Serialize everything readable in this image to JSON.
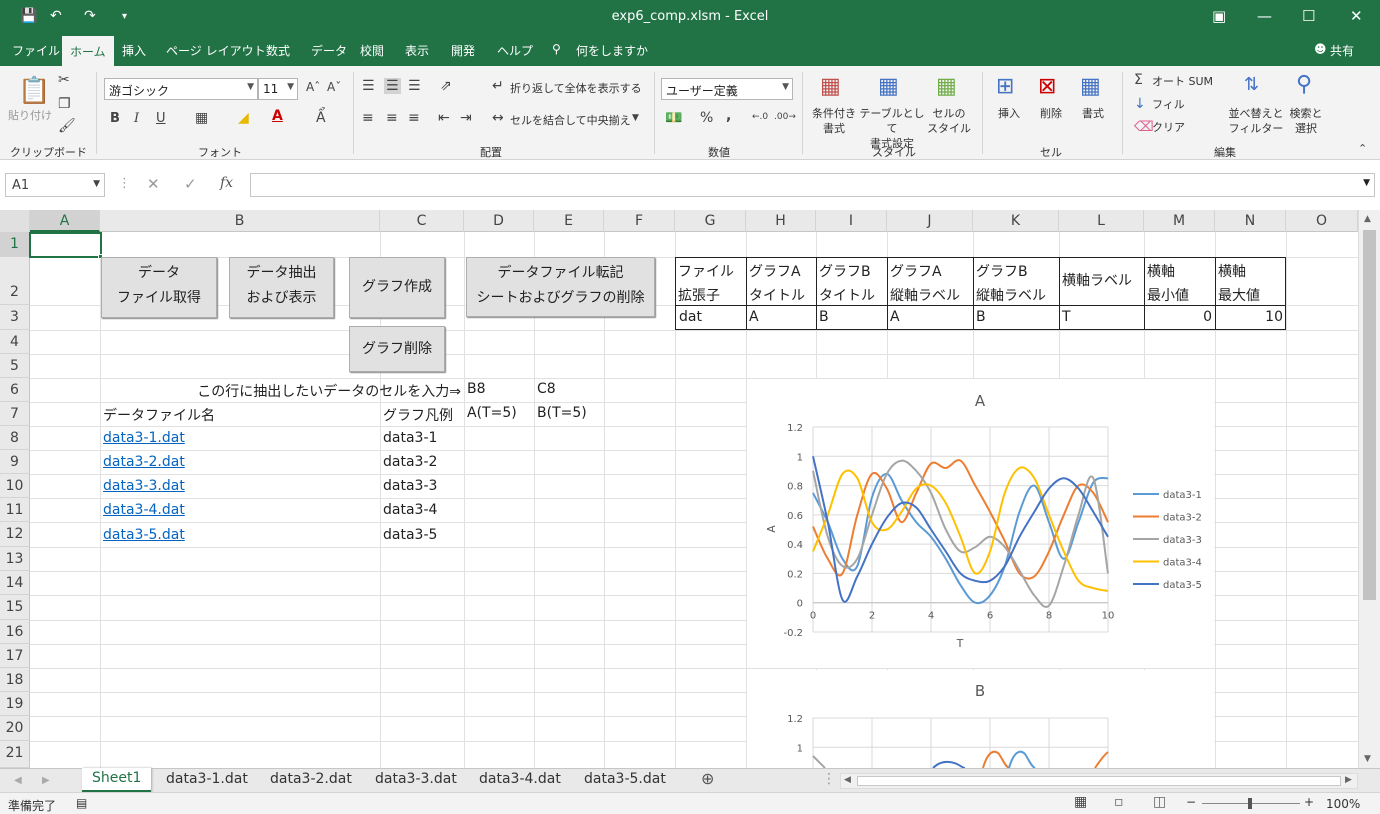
{
  "window": {
    "title": "exp6_comp.xlsm  -  Excel"
  },
  "menu": {
    "tabs": [
      "ファイル",
      "ホーム",
      "挿入",
      "ページ レイアウト",
      "数式",
      "データ",
      "校閲",
      "表示",
      "開発",
      "ヘルプ",
      "何をしますか"
    ],
    "active": "ホーム",
    "share": "共有"
  },
  "ribbon": {
    "clipboard": {
      "paste": "貼り付け",
      "group": "クリップボード"
    },
    "font": {
      "name": "游ゴシック",
      "size": "11",
      "bold": "B",
      "italic": "I",
      "underline": "U",
      "group": "フォント"
    },
    "alignment": {
      "wrap": "折り返して全体を表示する",
      "merge": "セルを結合して中央揃え",
      "group": "配置"
    },
    "number": {
      "format": "ユーザー定義",
      "percent": "%",
      "comma": ",",
      "group": "数値"
    },
    "styles": {
      "conditional": "条件付き\n書式",
      "table": "テーブルとして\n書式設定",
      "cell": "セルの\nスタイル",
      "group": "スタイル"
    },
    "cells": {
      "insert": "挿入",
      "delete": "削除",
      "format": "書式",
      "group": "セル"
    },
    "editing": {
      "autosum": "オート SUM",
      "fill": "フィル",
      "clear": "クリア",
      "sort": "並べ替えと\nフィルター",
      "find": "検索と\n選択",
      "group": "編集"
    }
  },
  "formula_bar": {
    "name_box": "A1",
    "fx": "fx",
    "value": ""
  },
  "columns": [
    "A",
    "B",
    "C",
    "D",
    "E",
    "F",
    "G",
    "H",
    "I",
    "J",
    "K",
    "L",
    "M",
    "N",
    "O"
  ],
  "rows": [
    "1",
    "2",
    "3",
    "4",
    "5",
    "6",
    "7",
    "8",
    "9",
    "10",
    "11",
    "12",
    "13",
    "14",
    "15",
    "16",
    "17",
    "18",
    "19",
    "20",
    "21"
  ],
  "buttons": {
    "get_file_l1": "データ",
    "get_file_l2": "ファイル取得",
    "extract_l1": "データ抽出",
    "extract_l2": "および表示",
    "make_graph": "グラフ作成",
    "delete_graph": "グラフ削除",
    "delete_sheets_l1": "データファイル転記",
    "delete_sheets_l2": "シートおよびグラフの削除"
  },
  "settings_table": {
    "headers": [
      [
        "ファイル",
        "拡張子"
      ],
      [
        "グラフA",
        "タイトル"
      ],
      [
        "グラフB",
        "タイトル"
      ],
      [
        "グラフA",
        "縦軸ラベル"
      ],
      [
        "グラフB",
        "縦軸ラベル"
      ],
      [
        "横軸ラベル",
        ""
      ],
      [
        "横軸",
        "最小値"
      ],
      [
        "横軸",
        "最大値"
      ]
    ],
    "values": [
      "dat",
      "A",
      "B",
      "A",
      "B",
      "T",
      "0",
      "10"
    ]
  },
  "cells": {
    "b6": "この行に抽出したいデータのセルを入力⇒",
    "d6": "B8",
    "e6": "C8",
    "b7": "データファイル名",
    "c7": "グラフ凡例",
    "d7": "A(T=5)",
    "e7": "B(T=5)",
    "files": [
      "data3-1.dat",
      "data3-2.dat",
      "data3-3.dat",
      "data3-4.dat",
      "data3-5.dat"
    ],
    "legends": [
      "data3-1",
      "data3-2",
      "data3-3",
      "data3-4",
      "data3-5"
    ]
  },
  "sheet_tabs": [
    "Sheet1",
    "data3-1.dat",
    "data3-2.dat",
    "data3-3.dat",
    "data3-4.dat",
    "data3-5.dat"
  ],
  "active_sheet": "Sheet1",
  "status": {
    "ready": "準備完了",
    "zoom": "100%"
  },
  "colors": {
    "excel_green": "#217346",
    "link": "#0563c1"
  },
  "chart_data": [
    {
      "type": "line",
      "title": "A",
      "xlabel": "T",
      "ylabel": "A",
      "xlim": [
        0,
        10
      ],
      "ylim": [
        -0.2,
        1.2
      ],
      "xticks": [
        "0",
        "2",
        "4",
        "6",
        "8",
        "10"
      ],
      "yticks": [
        "1.2",
        "1",
        "0.8",
        "0.6",
        "0.4",
        "0.2",
        "0",
        "-0.2"
      ],
      "legend_position": "right",
      "grid": true,
      "x": [
        0,
        0.5,
        1,
        1.5,
        2,
        2.5,
        3,
        3.5,
        4,
        4.5,
        5,
        5.5,
        6,
        6.5,
        7,
        7.5,
        8,
        8.5,
        9,
        9.5,
        10
      ],
      "series": [
        {
          "name": "data3-1",
          "color": "#5b9bd5",
          "values": [
            0.75,
            0.55,
            0.3,
            0.25,
            0.72,
            0.88,
            0.7,
            0.55,
            0.45,
            0.3,
            0.12,
            0.0,
            0.05,
            0.25,
            0.62,
            0.8,
            0.55,
            0.3,
            0.55,
            0.82,
            0.85
          ]
        },
        {
          "name": "data3-2",
          "color": "#ed7d31",
          "values": [
            0.52,
            0.3,
            0.2,
            0.6,
            0.88,
            0.78,
            0.55,
            0.75,
            0.95,
            0.92,
            0.97,
            0.8,
            0.62,
            0.42,
            0.2,
            0.18,
            0.35,
            0.6,
            0.8,
            0.75,
            0.55
          ]
        },
        {
          "name": "data3-3",
          "color": "#a5a5a5",
          "values": [
            0.9,
            0.45,
            0.25,
            0.3,
            0.6,
            0.88,
            0.97,
            0.9,
            0.75,
            0.5,
            0.35,
            0.38,
            0.45,
            0.38,
            0.22,
            0.05,
            -0.02,
            0.25,
            0.6,
            0.85,
            0.2
          ]
        },
        {
          "name": "data3-4",
          "color": "#ffc000",
          "values": [
            0.35,
            0.6,
            0.88,
            0.85,
            0.55,
            0.5,
            0.62,
            0.78,
            0.8,
            0.68,
            0.45,
            0.2,
            0.35,
            0.75,
            0.92,
            0.85,
            0.6,
            0.35,
            0.15,
            0.1,
            0.08
          ]
        },
        {
          "name": "data3-5",
          "color": "#4472c4",
          "values": [
            1.0,
            0.55,
            0.02,
            0.18,
            0.4,
            0.58,
            0.68,
            0.65,
            0.5,
            0.35,
            0.2,
            0.15,
            0.15,
            0.25,
            0.45,
            0.62,
            0.78,
            0.85,
            0.78,
            0.62,
            0.45
          ]
        }
      ]
    },
    {
      "type": "line",
      "title": "B",
      "ylim": [
        -0.2,
        1.2
      ],
      "yticks": [
        "1.2",
        "1"
      ],
      "partially_visible": true,
      "series": [
        {
          "name": "data3-1",
          "color": "#5b9bd5"
        },
        {
          "name": "data3-2",
          "color": "#ed7d31"
        },
        {
          "name": "data3-3",
          "color": "#a5a5a5"
        },
        {
          "name": "data3-4",
          "color": "#ffc000"
        },
        {
          "name": "data3-5",
          "color": "#4472c4"
        }
      ]
    }
  ]
}
